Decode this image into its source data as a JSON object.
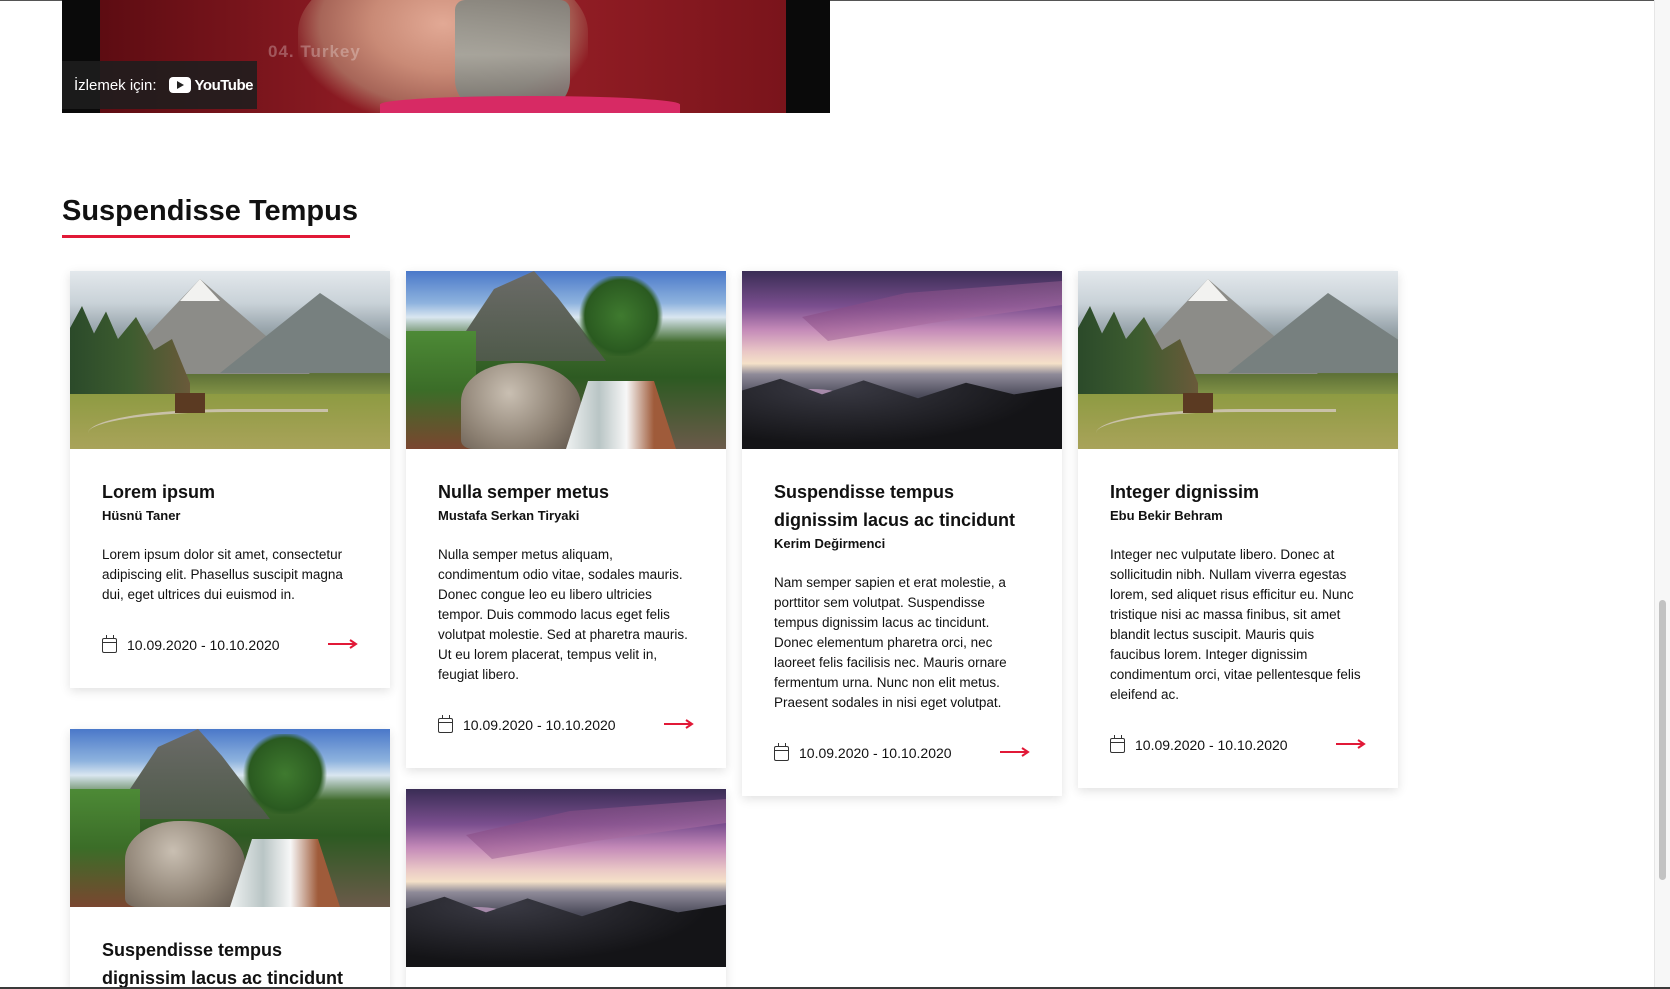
{
  "video": {
    "watch_label": "İzlemek için:",
    "platform": "YouTube",
    "overlay_caption": "04. Turkey"
  },
  "section": {
    "title": "Suspendisse Tempus"
  },
  "accent_color": "#e11937",
  "cards": [
    {
      "image": "mountain-valley",
      "title": "Lorem ipsum",
      "author": "Hüsnü Taner",
      "description": "Lorem ipsum dolor sit amet, consectetur adipiscing elit. Phasellus suscipit magna dui, eget ultrices dui euismod in.",
      "date": "10.09.2020 - 10.10.2020"
    },
    {
      "image": "waterfall",
      "title": "Nulla semper metus",
      "author": "Mustafa Serkan Tiryaki",
      "description": "Nulla semper metus aliquam, condimentum odio vitae, sodales mauris. Donec congue leo eu libero ultricies tempor. Duis commodo lacus eget felis volutpat molestie. Sed at pharetra mauris. Ut eu lorem placerat, tempus velit in, feugiat libero.",
      "date": "10.09.2020 - 10.10.2020"
    },
    {
      "image": "sunset-coast",
      "title": "Suspendisse tempus dignissim lacus ac tincidunt",
      "author": "Kerim Değirmenci",
      "description": "Nam semper sapien et erat molestie, a porttitor sem volutpat. Suspendisse tempus dignissim lacus ac tincidunt. Donec elementum pharetra orci, nec laoreet felis facilisis nec. Mauris ornare fermentum urna. Nunc non elit metus. Praesent sodales in nisi eget volutpat.",
      "date": "10.09.2020 - 10.10.2020"
    },
    {
      "image": "mountain-valley",
      "title": "Integer dignissim",
      "author": "Ebu Bekir Behram",
      "description": "Integer nec vulputate libero. Donec at sollicitudin nibh. Nullam viverra egestas lorem, sed aliquet risus efficitur eu. Nunc tristique nisi ac massa finibus, sit amet blandit lectus suscipit. Mauris quis faucibus lorem. Integer dignissim condimentum orci, vitae pellentesque felis eleifend ac.",
      "date": "10.09.2020 - 10.10.2020"
    },
    {
      "image": "waterfall",
      "title": "Suspendisse tempus dignissim lacus ac tincidunt"
    },
    {
      "image": "sunset-coast"
    }
  ]
}
